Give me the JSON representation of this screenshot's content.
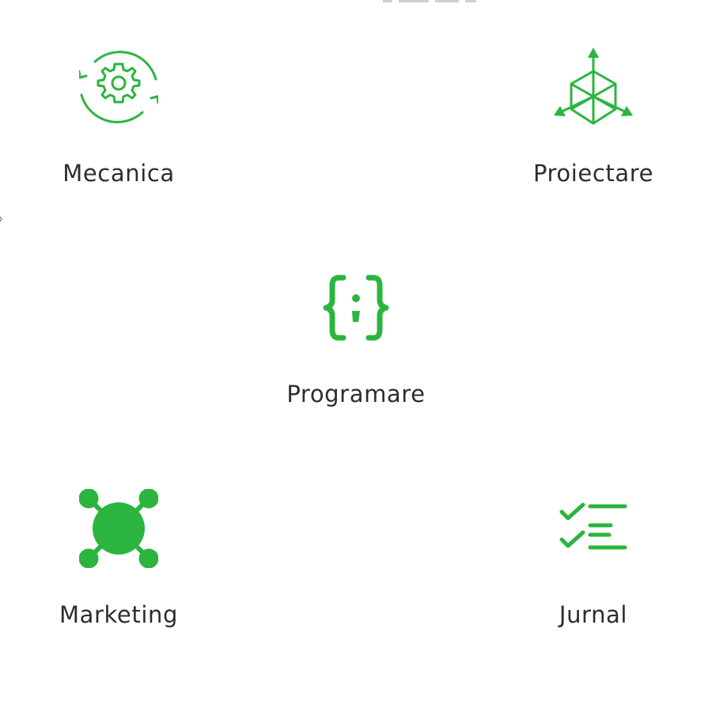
{
  "accent_color": "#2bb53f",
  "text_color": "#2d2d2d",
  "categories": {
    "mecanica": {
      "label": "Mecanica",
      "icon": "gear-cycle-icon"
    },
    "proiectare": {
      "label": "Proiectare",
      "icon": "3d-cube-axes-icon"
    },
    "programare": {
      "label": "Programare",
      "icon": "code-braces-icon"
    },
    "marketing": {
      "label": "Marketing",
      "icon": "network-hub-icon"
    },
    "jurnal": {
      "label": "Jurnal",
      "icon": "checklist-icon"
    }
  }
}
